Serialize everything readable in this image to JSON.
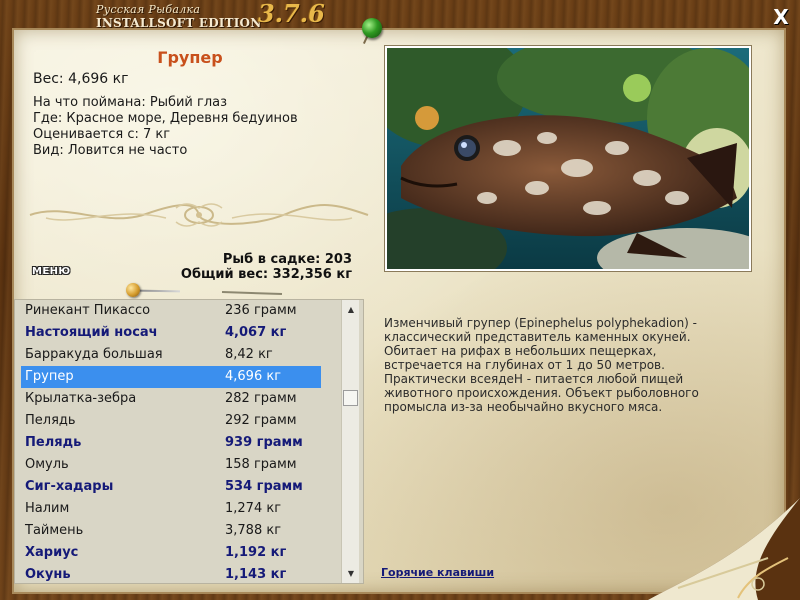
{
  "app": {
    "title_line1": "Русская Рыбалка",
    "title_line2": "INSTALLSOFT EDITION",
    "version": "3.7.6",
    "close_label": "X"
  },
  "fish": {
    "name": "Групер",
    "weight": "Вес: 4,696 кг",
    "info": [
      "На что поймана: Рыбий глаз",
      "Где: Красное море, Деревня бедуинов",
      "Оценивается с: 7 кг",
      "Вид: Ловится не часто"
    ],
    "description": "Изменчивый групер (Epinephelus polyphekadion) - классический представитель каменных окуней. Обитает на рифах в небольших пещерках, встречается на глубинах от 1 до 50 метров. Практически всеядеН - питается любой пищей животного происхождения. Объект рыболовного промысла из-за необычайно вкусного мяса."
  },
  "menu_label": "МЕНЮ",
  "stats": {
    "fish_count": "Рыб в садке: 203",
    "total_weight": "Общий вес: 332,356 кг"
  },
  "list": [
    {
      "name": "Ринекант Пикассо",
      "weight": "236 грамм",
      "bold": false,
      "selected": false
    },
    {
      "name": "Настоящий носач",
      "weight": "4,067 кг",
      "bold": true,
      "selected": false
    },
    {
      "name": "Барракуда большая",
      "weight": "8,42 кг",
      "bold": false,
      "selected": false
    },
    {
      "name": "Групер",
      "weight": "4,696 кг",
      "bold": false,
      "selected": true
    },
    {
      "name": "Крылатка-зебра",
      "weight": "282 грамм",
      "bold": false,
      "selected": false
    },
    {
      "name": "Пелядь",
      "weight": "292 грамм",
      "bold": false,
      "selected": false
    },
    {
      "name": "Пелядь",
      "weight": "939 грамм",
      "bold": true,
      "selected": false
    },
    {
      "name": "Омуль",
      "weight": "158 грамм",
      "bold": false,
      "selected": false
    },
    {
      "name": "Сиг-хадары",
      "weight": "534 грамм",
      "bold": true,
      "selected": false
    },
    {
      "name": "Налим",
      "weight": "1,274 кг",
      "bold": false,
      "selected": false
    },
    {
      "name": "Таймень",
      "weight": "3,788 кг",
      "bold": false,
      "selected": false
    },
    {
      "name": "Хариус",
      "weight": "1,192 кг",
      "bold": true,
      "selected": false
    },
    {
      "name": "Окунь",
      "weight": "1,143 кг",
      "bold": true,
      "selected": false
    }
  ],
  "scroll_up_icon": "▲",
  "scroll_down_icon": "▼",
  "hotkeys_label": "Горячие клавиши",
  "colors": {
    "title": "#c8501c",
    "selected_row": "#3b8fee",
    "bold_row": "#151a78",
    "link": "#151a78"
  }
}
